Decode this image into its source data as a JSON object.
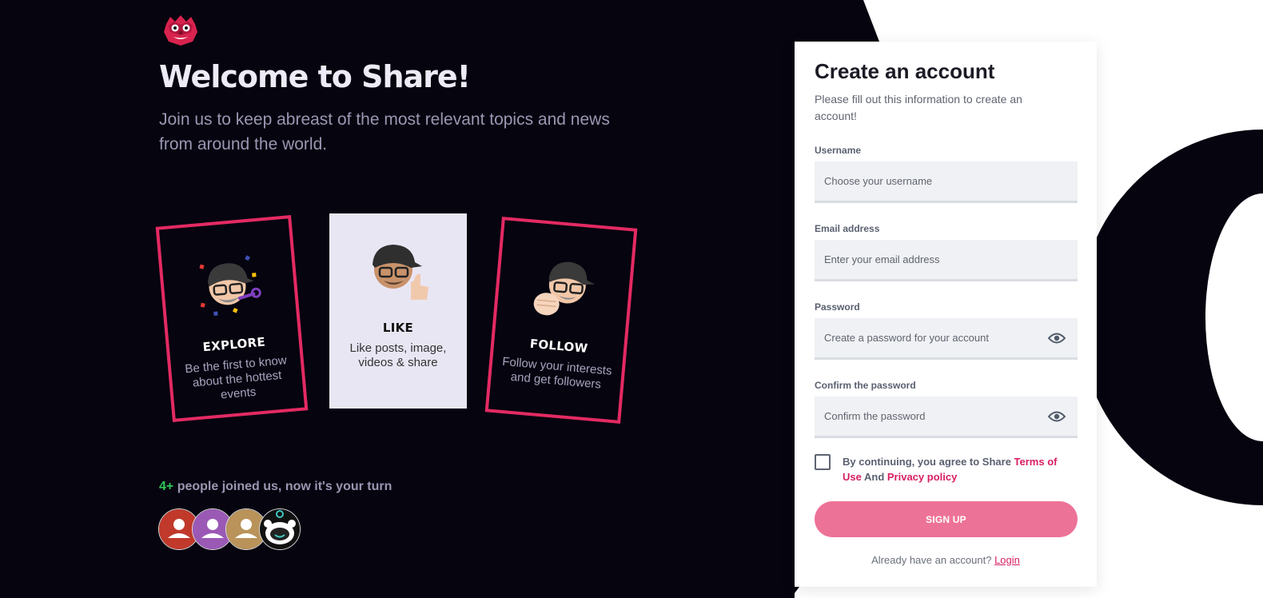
{
  "colors": {
    "dark_background": "#05040f",
    "accent_pink": "#e32a63",
    "button_pink": "#ed7297",
    "link_pink": "#d81e63",
    "green_count": "#2fc55a"
  },
  "brand": {
    "logo_icon": "red-lion-mascot-icon"
  },
  "hero": {
    "title": "Welcome to Share!",
    "subtitle": "Join us to keep abreast of the most relevant topics and news from around the world."
  },
  "features": [
    {
      "icon": "memoji-party-icon",
      "title": "EXPLORE",
      "text": "Be the first to know about the hottest events"
    },
    {
      "icon": "memoji-thumbs-up-icon",
      "title": "LIKE",
      "text": "Like posts, image, videos & share"
    },
    {
      "icon": "memoji-fist-bump-icon",
      "title": "FOLLOW",
      "text": "Follow your interests and get followers"
    }
  ],
  "community": {
    "count": "4+",
    "text": " people joined us, now it's your turn",
    "avatars": [
      {
        "icon": "user-avatar-icon",
        "color": "#c0392b"
      },
      {
        "icon": "user-avatar-icon",
        "color": "#9b59b6"
      },
      {
        "icon": "user-avatar-icon",
        "color": "#b9935a"
      },
      {
        "icon": "robot-avatar-icon",
        "color": "#111111"
      }
    ]
  },
  "form": {
    "title": "Create an account",
    "subtitle": "Please fill out this information to create an account!",
    "username": {
      "label": "Username",
      "placeholder": "Choose your username"
    },
    "email": {
      "label": "Email address",
      "placeholder": "Enter your email address"
    },
    "password": {
      "label": "Password",
      "placeholder": "Create a password for your account"
    },
    "confirm": {
      "label": "Confirm the password",
      "placeholder": "Confirm the password"
    },
    "agree": {
      "prefix": "By continuing, you agree to Share ",
      "terms": "Terms of Use",
      "and": " And ",
      "privacy": "Privacy policy"
    },
    "signup_label": "SIGN UP",
    "login_prompt": "Already have an account? ",
    "login_link": "Login"
  }
}
